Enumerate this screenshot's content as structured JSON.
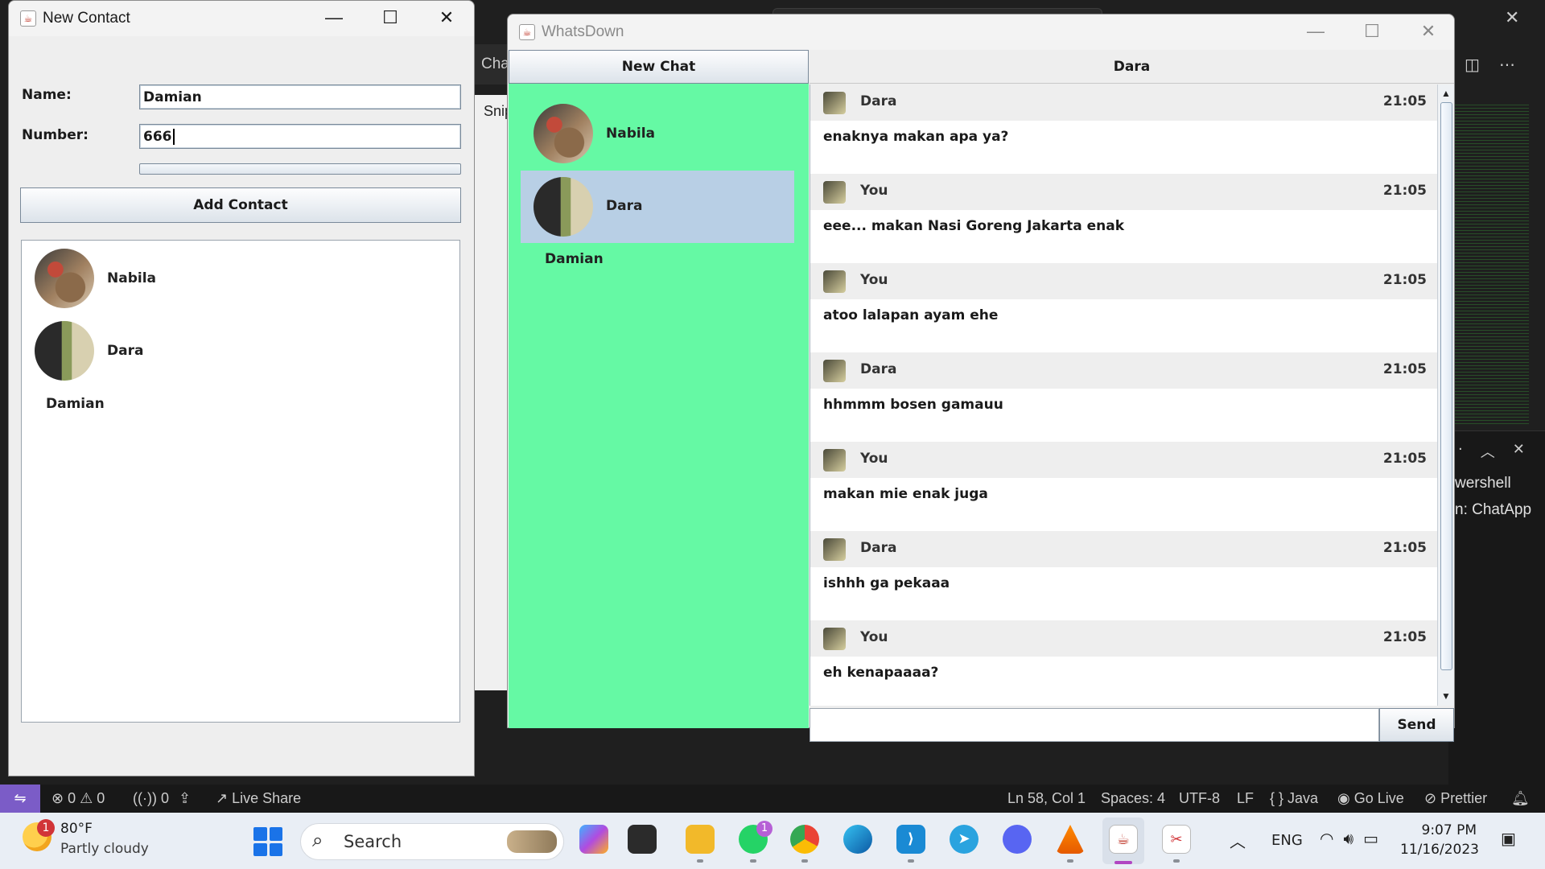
{
  "vscode": {
    "chat_tab": "Cha",
    "snip_label": "Snip",
    "terminal_line1": "wershell",
    "terminal_line2": "n: ChatApp",
    "status": {
      "errors": "0",
      "warnings": "0",
      "ports": "0",
      "live_share": "Live Share",
      "cursor": "Ln 58, Col 1",
      "spaces": "Spaces: 4",
      "encoding": "UTF-8",
      "eol": "LF",
      "language": "Java",
      "go_live": "Go Live",
      "prettier": "Prettier"
    }
  },
  "new_contact": {
    "title": "New Contact",
    "name_label": "Name:",
    "name_value": "Damian",
    "number_label": "Number:",
    "number_value": "666",
    "add_button": "Add Contact",
    "contacts": [
      {
        "name": "Nabila",
        "avatar": "photo-a"
      },
      {
        "name": "Dara",
        "avatar": "photo-b"
      },
      {
        "name": "Damian",
        "avatar": ""
      }
    ]
  },
  "whatsdown": {
    "title": "WhatsDown",
    "new_chat_button": "New Chat",
    "chats": [
      {
        "name": "Nabila",
        "selected": false
      },
      {
        "name": "Dara",
        "selected": true
      },
      {
        "name": "Damian",
        "selected": false
      }
    ],
    "active_chat": "Dara",
    "messages": [
      {
        "sender": "Dara",
        "time": "21:05",
        "text": "enaknya makan apa ya?"
      },
      {
        "sender": "You",
        "time": "21:05",
        "text": "eee... makan Nasi Goreng Jakarta enak"
      },
      {
        "sender": "You",
        "time": "21:05",
        "text": "atoo lalapan ayam ehe"
      },
      {
        "sender": "Dara",
        "time": "21:05",
        "text": "hhmmm bosen gamauu"
      },
      {
        "sender": "You",
        "time": "21:05",
        "text": "makan mie enak juga"
      },
      {
        "sender": "Dara",
        "time": "21:05",
        "text": "ishhh ga pekaaa"
      },
      {
        "sender": "You",
        "time": "21:05",
        "text": "eh kenapaaaa?"
      }
    ],
    "message_input": "",
    "send_button": "Send"
  },
  "taskbar": {
    "weather_temp": "80°F",
    "weather_desc": "Partly cloudy",
    "weather_badge": "1",
    "search_label": "Search",
    "whatsapp_badge": "1",
    "lang": "ENG",
    "time": "9:07 PM",
    "date": "11/16/2023"
  }
}
